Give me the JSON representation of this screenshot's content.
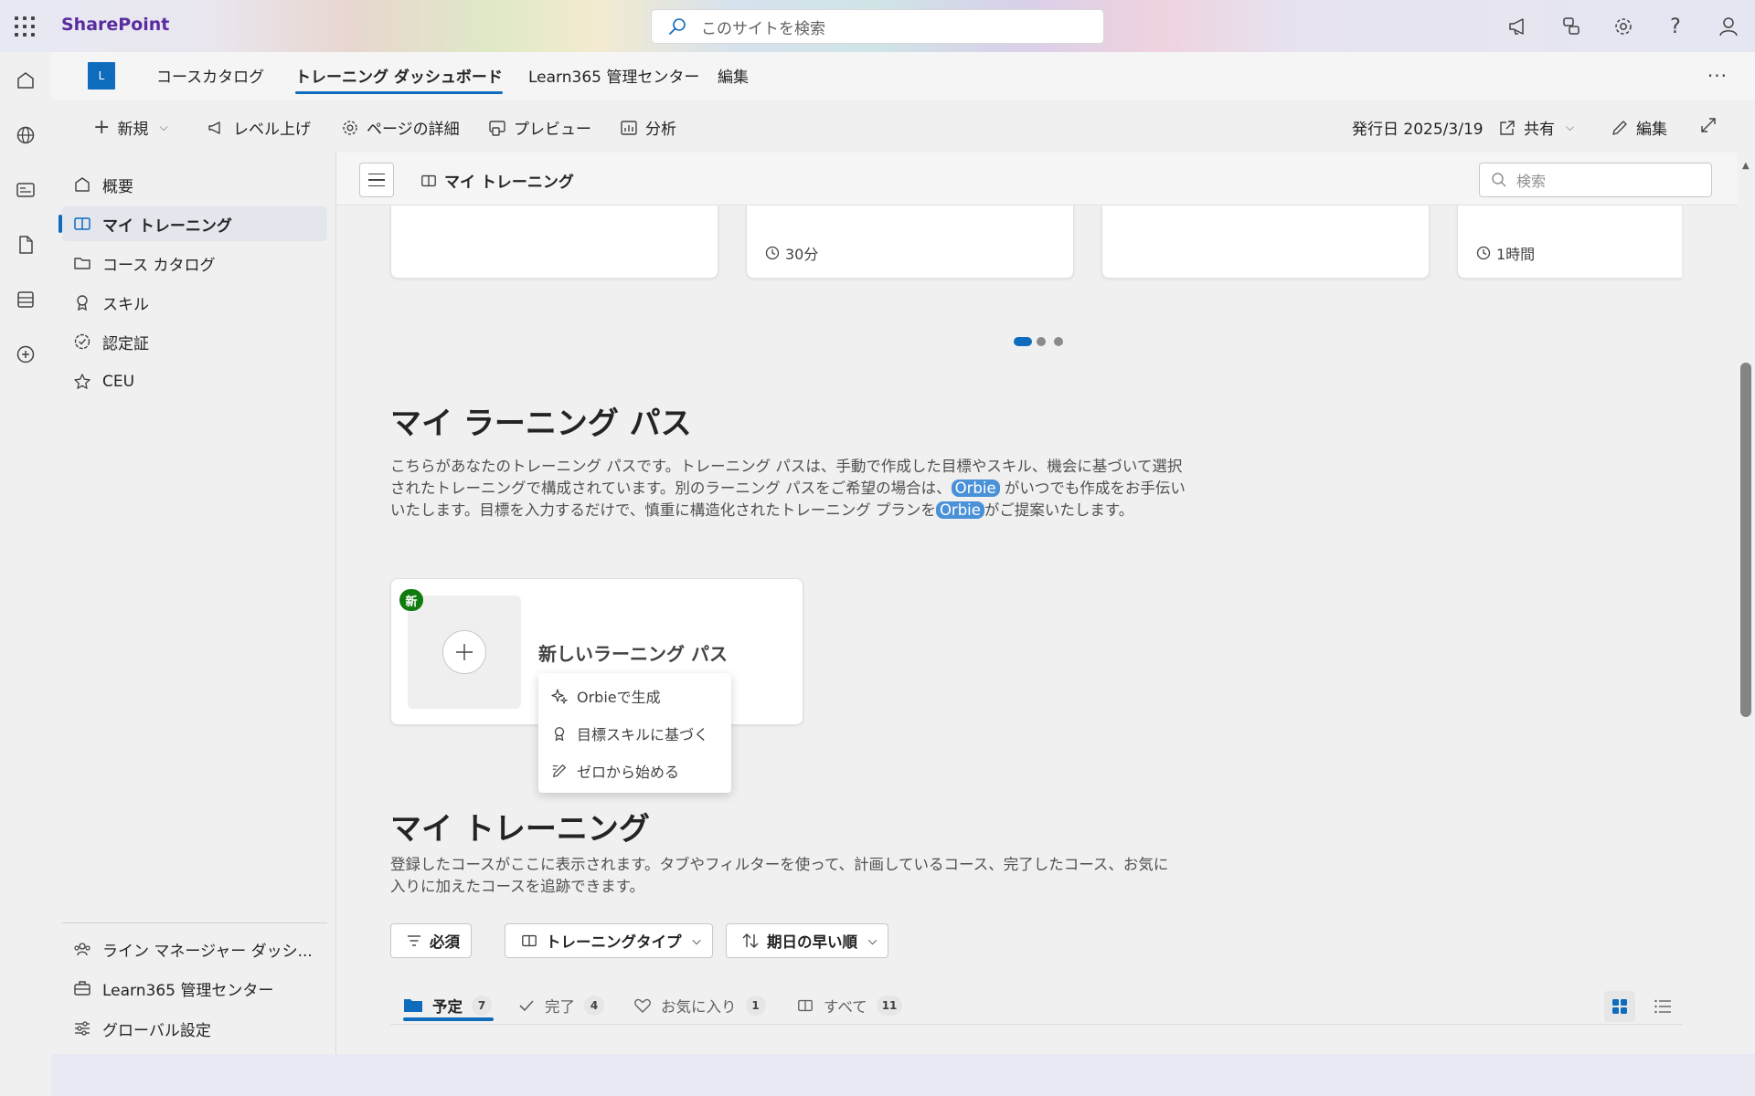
{
  "suite": {
    "brand": "SharePoint",
    "search_placeholder": "このサイトを検索"
  },
  "site_nav": {
    "logo_letter": "L",
    "items": [
      {
        "label": "コースカタログ"
      },
      {
        "label": "トレーニング ダッシュボード"
      },
      {
        "label": "Learn365 管理センター"
      },
      {
        "label": "編集"
      }
    ],
    "active": "トレーニング ダッシュボード",
    "more": "···"
  },
  "command_bar": {
    "new": "新規",
    "level_up": "レベル上げ",
    "page_details": "ページの詳細",
    "preview": "プレビュー",
    "analytics": "分析",
    "published": "発行日 2025/3/19",
    "share": "共有",
    "edit": "編集"
  },
  "left_nav": {
    "items": [
      {
        "label": "概要",
        "icon": "home-icon"
      },
      {
        "label": "マイ トレーニング",
        "icon": "book-icon"
      },
      {
        "label": "コース カタログ",
        "icon": "folder-icon"
      },
      {
        "label": "スキル",
        "icon": "ribbon-icon"
      },
      {
        "label": "認定証",
        "icon": "certificate-icon"
      },
      {
        "label": "CEU",
        "icon": "star-icon"
      }
    ],
    "selected": "マイ トレーニング",
    "bottom_items": [
      {
        "label": "ライン マネージャー ダッシ...",
        "icon": "people-icon"
      },
      {
        "label": "Learn365 管理センター",
        "icon": "toolbox-icon"
      },
      {
        "label": "グローバル設定",
        "icon": "settings-sliders-icon"
      }
    ]
  },
  "content_header": {
    "title": "マイ トレーニング",
    "search_placeholder": "検索"
  },
  "carousel": {
    "cards": [
      {
        "duration": ""
      },
      {
        "duration": "30分"
      },
      {
        "duration": ""
      },
      {
        "duration": "1時間"
      }
    ],
    "page_count": 3,
    "active_page": 1
  },
  "learning_paths": {
    "heading": "マイ ラーニング パス",
    "description_parts": [
      "こちらがあなたのトレーニング パスです。トレーニング パスは、手動で作成した目標やスキル、機会に基づいて選択されたトレーニングで構成されています。別のラーニング パスをご希望の場合は、",
      "Orbie",
      " がいつでも作成をお手伝いいたします。目標を入力するだけで、慎重に構造化されたトレーニング プランを",
      "Orbie",
      "がご提案いたします。"
    ],
    "new_badge": "新",
    "new_card_title": "新しいラーニング パス",
    "menu": [
      {
        "label": "Orbieで生成",
        "icon": "sparkle-icon"
      },
      {
        "label": "目標スキルに基づく",
        "icon": "ribbon-icon"
      },
      {
        "label": "ゼロから始める",
        "icon": "pencil-icon"
      }
    ]
  },
  "my_training": {
    "heading": "マイ トレーニング",
    "description": "登録したコースがここに表示されます。タブやフィルターを使って、計画しているコース、完了したコース、お気に入りに加えたコースを追跡できます。",
    "filters": [
      {
        "label": "必須",
        "icon": "filter-icon"
      },
      {
        "label": "トレーニングタイプ",
        "icon": "book-icon"
      },
      {
        "label": "期日の早い順",
        "icon": "sort-icon"
      }
    ],
    "tabs": [
      {
        "label": "予定",
        "count": "7",
        "icon": "folder-icon"
      },
      {
        "label": "完了",
        "count": "4",
        "icon": "checkmark-icon"
      },
      {
        "label": "お気に入り",
        "count": "1",
        "icon": "heart-icon"
      },
      {
        "label": "すべて",
        "count": "11",
        "icon": "book-icon"
      }
    ],
    "active_tab": "予定"
  },
  "colors": {
    "accent": "#0f6cbd",
    "brand_purple": "#5a2ca0",
    "new_badge": "#107c10",
    "orbie_highlight": "#4a91d8"
  }
}
